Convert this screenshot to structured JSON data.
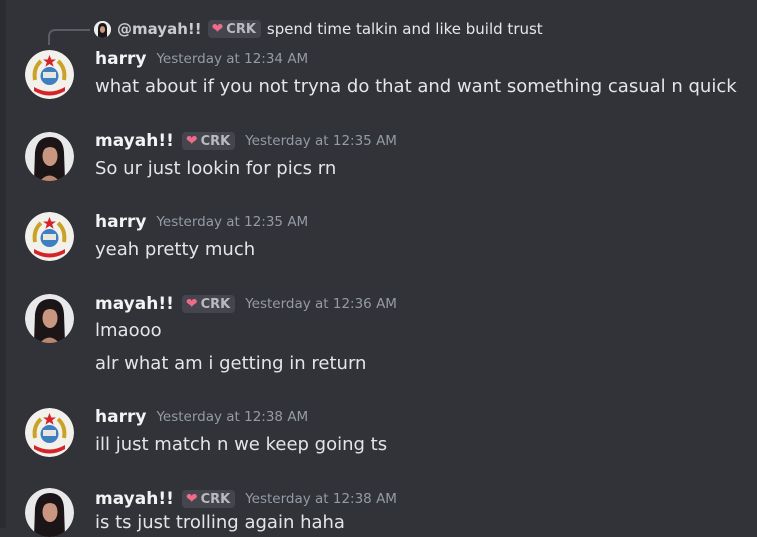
{
  "reply": {
    "mention": "@mayah!!",
    "tag": "CRK",
    "text": "spend time talkin and like build trust"
  },
  "messages": [
    {
      "author": "harry",
      "timestamp": "Yesterday at 12:34 AM",
      "lines": [
        "what about if you not tryna do that and want something casual n quick"
      ]
    },
    {
      "author": "mayah!!",
      "tag": "CRK",
      "timestamp": "Yesterday at 12:35 AM",
      "lines": [
        "So ur just lookin for pics rn"
      ]
    },
    {
      "author": "harry",
      "timestamp": "Yesterday at 12:35 AM",
      "lines": [
        "yeah pretty much"
      ]
    },
    {
      "author": "mayah!!",
      "tag": "CRK",
      "timestamp": "Yesterday at 12:36 AM",
      "lines": [
        "lmaooo",
        "alr what am i getting in return"
      ]
    },
    {
      "author": "harry",
      "timestamp": "Yesterday at 12:38 AM",
      "lines": [
        "ill just match n we keep going ts"
      ]
    },
    {
      "author": "mayah!!",
      "tag": "CRK",
      "timestamp": "Yesterday at 12:38 AM",
      "lines": [
        "is ts just trolling again haha"
      ]
    }
  ],
  "icons": {
    "harry_avatar": "emblem-avatar",
    "mayah_avatar": "portrait-avatar",
    "tag_icon": "heart-icon"
  },
  "colors": {
    "background": "#323339",
    "username": "#f2f3f5",
    "timestamp": "#949ba4",
    "tag_bg": "#45464d",
    "heart": "#f06b8a"
  }
}
